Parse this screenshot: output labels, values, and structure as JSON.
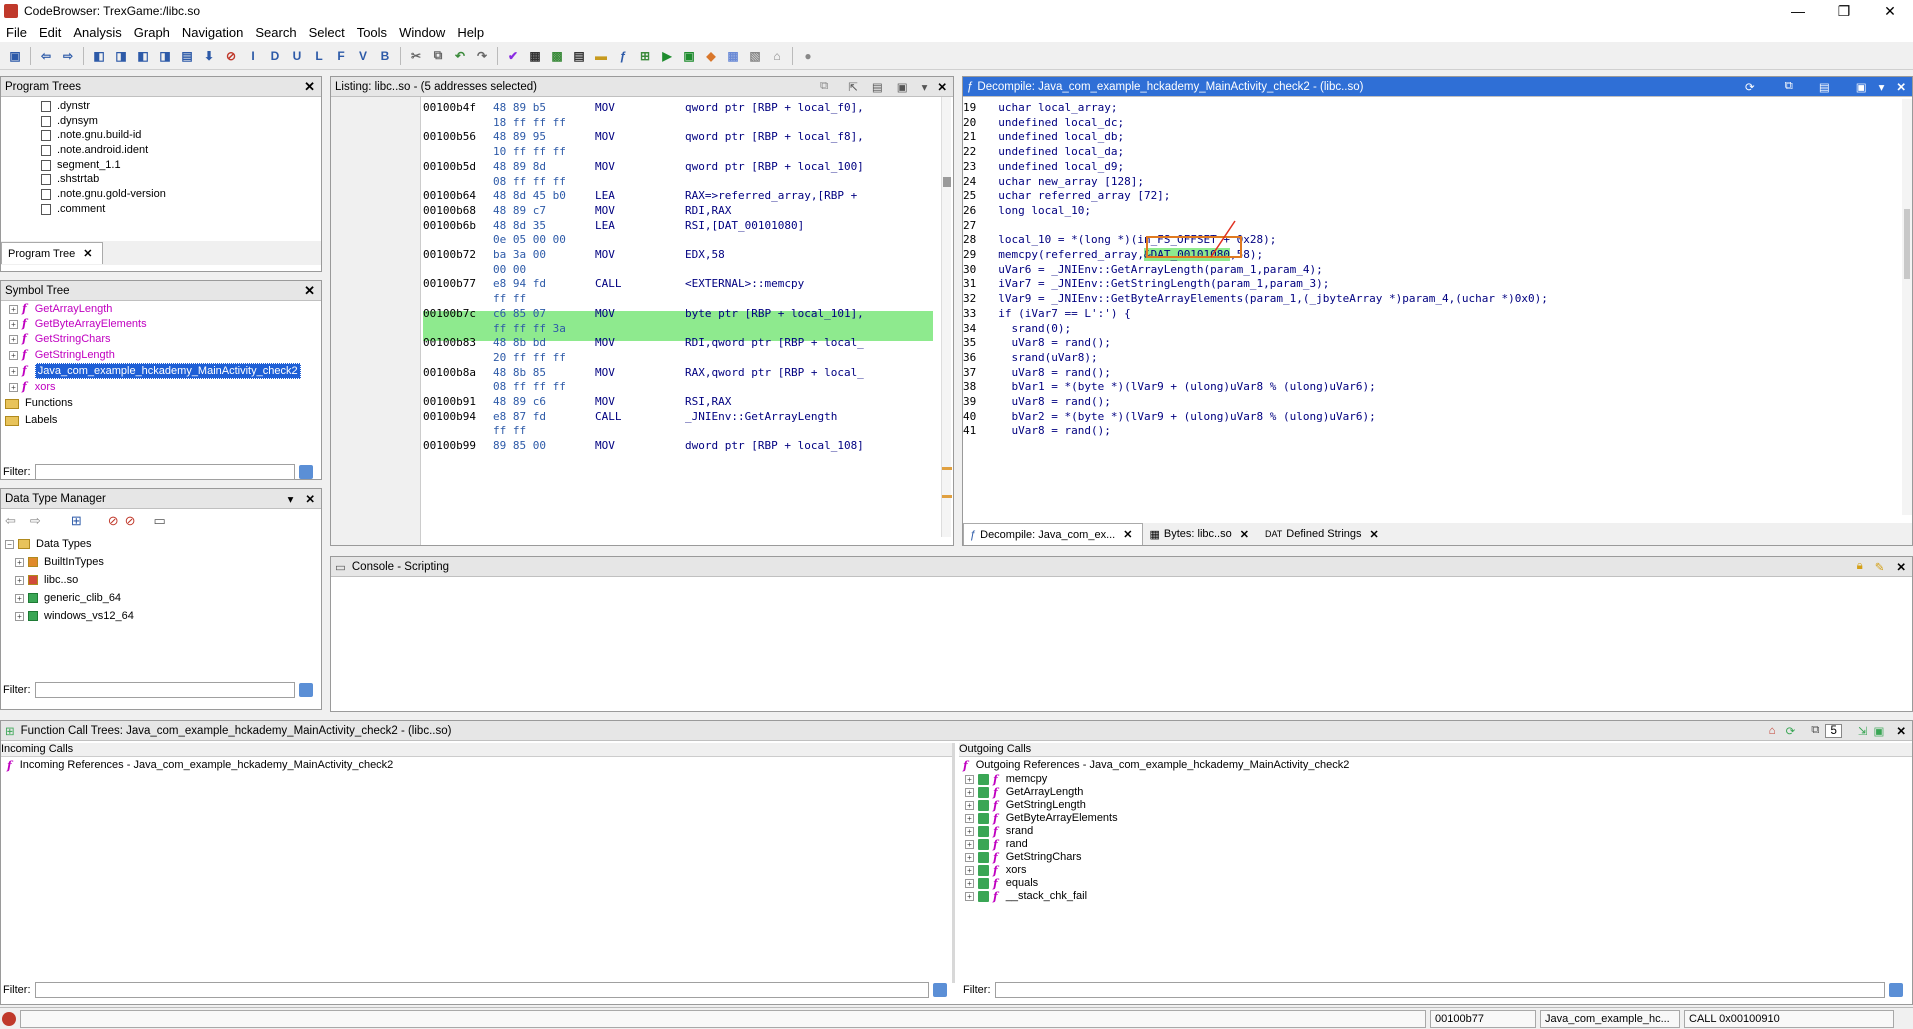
{
  "window": {
    "title": "CodeBrowser: TrexGame:/libc.so",
    "min": "—",
    "max": "❐",
    "close": "✕"
  },
  "menu": [
    "File",
    "Edit",
    "Analysis",
    "Graph",
    "Navigation",
    "Search",
    "Select",
    "Tools",
    "Window",
    "Help"
  ],
  "program_trees": {
    "title": "Program Trees",
    "items": [
      ".dynstr",
      ".dynsym",
      ".note.gnu.build-id",
      ".note.android.ident",
      "segment_1.1",
      ".shstrtab",
      ".note.gnu.gold-version",
      ".comment"
    ],
    "tab": "Program Tree"
  },
  "symbol_tree": {
    "title": "Symbol Tree",
    "functions": [
      "GetArrayLength",
      "GetByteArrayElements",
      "GetStringChars",
      "GetStringLength",
      "Java_com_example_hckademy_MainActivity_check2",
      "xors"
    ],
    "folders": [
      "Functions",
      "Labels"
    ],
    "filter_label": "Filter:"
  },
  "data_type_manager": {
    "title": "Data Type Manager",
    "root": "Data Types",
    "items": [
      "BuiltInTypes",
      "libc..so",
      "generic_clib_64",
      "windows_vs12_64"
    ],
    "filter_label": "Filter:"
  },
  "listing": {
    "title": "Listing:  libc..so - (5 addresses selected)",
    "rows": [
      {
        "addr": "00100b4f",
        "bytes": "48 89 b5",
        "mnem": "MOV",
        "ops": "qword ptr [RBP + local_f0],"
      },
      {
        "addr": "",
        "bytes": "18 ff ff ff",
        "mnem": "",
        "ops": ""
      },
      {
        "addr": "00100b56",
        "bytes": "48 89 95",
        "mnem": "MOV",
        "ops": "qword ptr [RBP + local_f8],"
      },
      {
        "addr": "",
        "bytes": "10 ff ff ff",
        "mnem": "",
        "ops": ""
      },
      {
        "addr": "00100b5d",
        "bytes": "48 89 8d",
        "mnem": "MOV",
        "ops": "qword ptr [RBP + local_100]"
      },
      {
        "addr": "",
        "bytes": "08 ff ff ff",
        "mnem": "",
        "ops": ""
      },
      {
        "addr": "00100b64",
        "bytes": "48 8d 45 b0",
        "mnem": "LEA",
        "ops": "RAX=>referred_array,[RBP +"
      },
      {
        "addr": "00100b68",
        "bytes": "48 89 c7",
        "mnem": "MOV",
        "ops": "RDI,RAX"
      },
      {
        "addr": "00100b6b",
        "bytes": "48 8d 35",
        "mnem": "LEA",
        "ops": "RSI,[DAT_00101080]"
      },
      {
        "addr": "",
        "bytes": "0e 05 00 00",
        "mnem": "",
        "ops": ""
      },
      {
        "addr": "00100b72",
        "bytes": "ba 3a 00",
        "mnem": "MOV",
        "ops": "EDX,58"
      },
      {
        "addr": "",
        "bytes": "00 00",
        "mnem": "",
        "ops": ""
      },
      {
        "addr": "00100b77",
        "bytes": "e8 94 fd",
        "mnem": "CALL",
        "ops": "<EXTERNAL>::memcpy"
      },
      {
        "addr": "",
        "bytes": "ff ff",
        "mnem": "",
        "ops": ""
      },
      {
        "addr": "00100b7c",
        "bytes": "c6 85 07",
        "mnem": "MOV",
        "ops": "byte ptr [RBP + local_101],"
      },
      {
        "addr": "",
        "bytes": "ff ff ff 3a",
        "mnem": "",
        "ops": ""
      },
      {
        "addr": "00100b83",
        "bytes": "48 8b bd",
        "mnem": "MOV",
        "ops": "RDI,qword ptr [RBP + local_"
      },
      {
        "addr": "",
        "bytes": "20 ff ff ff",
        "mnem": "",
        "ops": ""
      },
      {
        "addr": "00100b8a",
        "bytes": "48 8b 85",
        "mnem": "MOV",
        "ops": "RAX,qword ptr [RBP + local_"
      },
      {
        "addr": "",
        "bytes": "08 ff ff ff",
        "mnem": "",
        "ops": ""
      },
      {
        "addr": "00100b91",
        "bytes": "48 89 c6",
        "mnem": "MOV",
        "ops": "RSI,RAX"
      },
      {
        "addr": "00100b94",
        "bytes": "e8 87 fd",
        "mnem": "CALL",
        "ops": "_JNIEnv::GetArrayLength"
      },
      {
        "addr": "",
        "bytes": "ff ff",
        "mnem": "",
        "ops": ""
      },
      {
        "addr": "00100b99",
        "bytes": "89 85 00",
        "mnem": "MOV",
        "ops": "dword ptr [RBP + local_108]"
      }
    ]
  },
  "decompile": {
    "title": "Decompile: Java_com_example_hckademy_MainActivity_check2 - (libc..so)",
    "lines": [
      {
        "n": "19",
        "code": "  uchar local_array;"
      },
      {
        "n": "20",
        "code": "  undefined local_dc;"
      },
      {
        "n": "21",
        "code": "  undefined local_db;"
      },
      {
        "n": "22",
        "code": "  undefined local_da;"
      },
      {
        "n": "23",
        "code": "  undefined local_d9;"
      },
      {
        "n": "24",
        "code": "  uchar new_array [128];"
      },
      {
        "n": "25",
        "code": "  uchar referred_array [72];"
      },
      {
        "n": "26",
        "code": "  long local_10;"
      },
      {
        "n": "27",
        "code": "  "
      },
      {
        "n": "28",
        "code": "  local_10 = *(long *)(in_FS_OFFSET + 0x28);"
      },
      {
        "n": "29",
        "code": "  memcpy(referred_array,&DAT_00101080,58);"
      },
      {
        "n": "30",
        "code": "  uVar6 = _JNIEnv::GetArrayLength(param_1,param_4);"
      },
      {
        "n": "31",
        "code": "  iVar7 = _JNIEnv::GetStringLength(param_1,param_3);"
      },
      {
        "n": "32",
        "code": "  lVar9 = _JNIEnv::GetByteArrayElements(param_1,(_jbyteArray *)param_4,(uchar *)0x0);"
      },
      {
        "n": "33",
        "code": "  if (iVar7 == L':') {"
      },
      {
        "n": "34",
        "code": "    srand(0);"
      },
      {
        "n": "35",
        "code": "    uVar8 = rand();"
      },
      {
        "n": "36",
        "code": "    srand(uVar8);"
      },
      {
        "n": "37",
        "code": "    uVar8 = rand();"
      },
      {
        "n": "38",
        "code": "    bVar1 = *(byte *)(lVar9 + (ulong)uVar8 % (ulong)uVar6);"
      },
      {
        "n": "39",
        "code": "    uVar8 = rand();"
      },
      {
        "n": "40",
        "code": "    bVar2 = *(byte *)(lVar9 + (ulong)uVar8 % (ulong)uVar6);"
      },
      {
        "n": "41",
        "code": "    uVar8 = rand();"
      }
    ],
    "highlight": "&DAT_00101080",
    "tabs": [
      "Decompile: Java_com_ex...",
      "Bytes: libc..so",
      "Defined Strings"
    ]
  },
  "console": {
    "title": "Console - Scripting"
  },
  "call_trees": {
    "title": "Function Call Trees: Java_com_example_hckademy_MainActivity_check2 -  (libc..so)",
    "count": "5",
    "incoming_label": "Incoming Calls",
    "incoming_root": "Incoming References - Java_com_example_hckademy_MainActivity_check2",
    "outgoing_label": "Outgoing Calls",
    "outgoing_root": "Outgoing References - Java_com_example_hckademy_MainActivity_check2",
    "outgoing": [
      "memcpy",
      "GetArrayLength",
      "GetStringLength",
      "GetByteArrayElements",
      "srand",
      "rand",
      "GetStringChars",
      "xors",
      "equals",
      "__stack_chk_fail"
    ],
    "filter_label": "Filter:"
  },
  "status": {
    "addr": "00100b77",
    "func": "Java_com_example_hc...",
    "instr": "CALL 0x00100910"
  },
  "icons": {
    "f": "f",
    "doc": "document-icon"
  }
}
